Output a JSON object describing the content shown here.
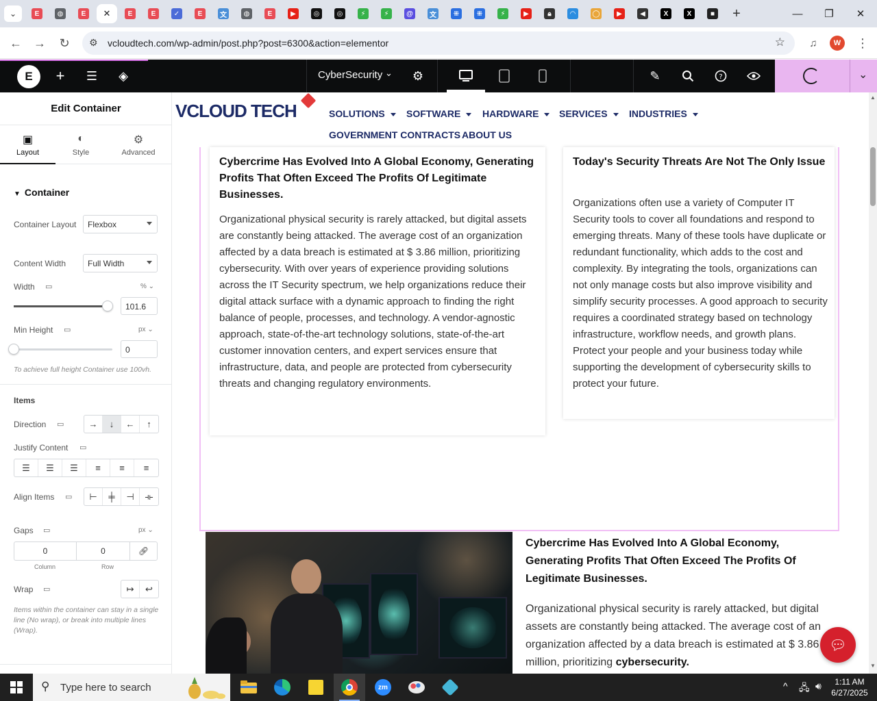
{
  "browser": {
    "tabs": [
      {
        "icon": "elementor-tab-icon",
        "color": "#e84c55"
      },
      {
        "icon": "globe-tab-icon",
        "color": "#5f6368"
      },
      {
        "icon": "elementor-tab-icon",
        "color": "#e84c55"
      },
      {
        "icon": "close-icon",
        "color": "#202124",
        "active": true
      },
      {
        "icon": "elementor-tab-icon",
        "color": "#e84c55"
      },
      {
        "icon": "elementor-tab-icon",
        "color": "#e84c55"
      },
      {
        "icon": "check-tab-icon",
        "color": "#4b6bd8"
      },
      {
        "icon": "elementor-tab-icon",
        "color": "#e84c55"
      },
      {
        "icon": "translate-tab-icon",
        "color": "#4a8fd8"
      },
      {
        "icon": "globe-tab-icon",
        "color": "#5f6368"
      },
      {
        "icon": "elementor-tab-icon",
        "color": "#e84c55"
      },
      {
        "icon": "youtube-tab-icon",
        "color": "#e62117"
      },
      {
        "icon": "openai-tab-icon",
        "color": "#111111"
      },
      {
        "icon": "openai-tab-icon",
        "color": "#111111"
      },
      {
        "icon": "leaf-tab-icon",
        "color": "#36b24a"
      },
      {
        "icon": "leaf-tab-icon",
        "color": "#36b24a"
      },
      {
        "icon": "spiral-tab-icon",
        "color": "#5a4ee0"
      },
      {
        "icon": "translate-tab-icon",
        "color": "#4a8fd8"
      },
      {
        "icon": "grid-tab-icon",
        "color": "#2b6fe0"
      },
      {
        "icon": "grid-tab-icon",
        "color": "#2b6fe0"
      },
      {
        "icon": "leaf-tab-icon",
        "color": "#36b24a"
      },
      {
        "icon": "youtube-tab-icon",
        "color": "#e62117"
      },
      {
        "icon": "lock-tab-icon",
        "color": "#333333"
      },
      {
        "icon": "wave-tab-icon",
        "color": "#2b8de0"
      },
      {
        "icon": "circle-tab-icon",
        "color": "#e9a63a"
      },
      {
        "icon": "youtube-tab-icon",
        "color": "#e62117"
      },
      {
        "icon": "speaker-tab-icon",
        "color": "#333333"
      },
      {
        "icon": "x-tab-icon",
        "color": "#000000"
      },
      {
        "icon": "x-tab-icon",
        "color": "#000000"
      },
      {
        "icon": "square-tab-icon",
        "color": "#222222"
      }
    ],
    "url": "vcloudtech.com/wp-admin/post.php?post=6300&action=elementor",
    "profile_initial": "W"
  },
  "editor": {
    "page_name": "CyberSecurity",
    "accent_color": "#e9b6f0"
  },
  "panel": {
    "title": "Edit Container",
    "tabs": [
      {
        "label": "Layout",
        "icon": "layout-icon",
        "active": true
      },
      {
        "label": "Style",
        "icon": "contrast-icon"
      },
      {
        "label": "Advanced",
        "icon": "gear-icon"
      }
    ],
    "section_title": "Container",
    "container_layout": {
      "label": "Container Layout",
      "value": "Flexbox"
    },
    "content_width": {
      "label": "Content Width",
      "value": "Full Width"
    },
    "width": {
      "label": "Width",
      "unit": "%",
      "value": "101.6",
      "fraction": 0.95
    },
    "min_height": {
      "label": "Min Height",
      "unit": "px",
      "value": "0",
      "fraction": 0.0
    },
    "min_height_hint": "To achieve full height Container use 100vh.",
    "items_heading": "Items",
    "direction": {
      "label": "Direction",
      "selected": 1
    },
    "justify_content": {
      "label": "Justify Content"
    },
    "align_items": {
      "label": "Align Items"
    },
    "gaps": {
      "label": "Gaps",
      "unit": "px",
      "column": "0",
      "row": "0",
      "column_label": "Column",
      "row_label": "Row"
    },
    "wrap": {
      "label": "Wrap"
    },
    "wrap_hint": "Items within the container can stay in a single line (No wrap), or break into multiple lines (Wrap)."
  },
  "site": {
    "logo_main": "VCLOUD TECH",
    "menu_row1": [
      "SOLUTIONS",
      "SOFTWARE",
      "HARDWARE",
      "SERVICES",
      "INDUSTRIES"
    ],
    "menu_row2": [
      "GOVERNMENT CONTRACTS",
      "ABOUT US"
    ],
    "card_left": {
      "title": "Cybercrime Has Evolved Into A Global Economy, Generating Profits That Often Exceed The Profits Of Legitimate Businesses.",
      "body": "Organizational physical security is rarely attacked, but digital assets are constantly being attacked. The average cost of an organization affected by a data breach is estimated at $ 3.86 million, prioritizing cybersecurity. With over years of experience providing solutions across the IT Security spectrum, we help organizations reduce their digital attack surface with a dynamic approach to finding the right balance of people, processes, and technology. A vendor-agnostic approach, state-of-the-art technology solutions, state-of-the-art customer innovation centers, and expert services ensure that infrastructure, data, and people are protected from cybersecurity threats and changing regulatory environments."
    },
    "card_right": {
      "title": "Today's Security Threats Are Not The Only Issue",
      "body": "Organizations often use a variety of Computer IT Security tools to cover all foundations and respond to emerging threats. Many of these tools have duplicate or redundant functionality, which adds to the cost and complexity. By integrating the tools, organizations can not only manage costs but also improve visibility and simplify security processes. A good approach to security requires a coordinated strategy based on technology infrastructure, workflow needs, and growth plans. Protect your people and your business today while supporting the development of cybersecurity skills to protect your future."
    },
    "lower_title": "Cybercrime Has Evolved Into A Global Economy, Generating Profits That Often Exceed The Profits Of Legitimate Businesses.",
    "lower_text": "Organizational physical security is rarely attacked, but digital assets are constantly being attacked. The average cost of an organization affected by a data breach is estimated at $ 3.86 million, prioritizing",
    "lower_text_bold": "cybersecurity."
  },
  "taskbar": {
    "search_placeholder": "Type here to search",
    "time": "1:11 AM",
    "date": "6/27/2025"
  }
}
